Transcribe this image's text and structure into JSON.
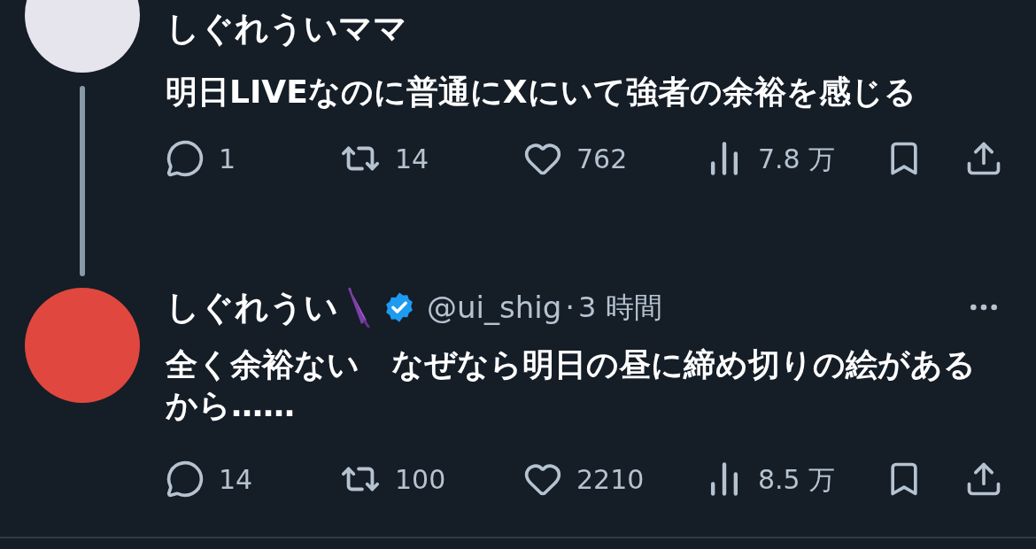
{
  "tweets": [
    {
      "author": {
        "name": "しぐれういママ",
        "color": "#e6e4ec"
      },
      "body": "明日LIVEなのに普通にXにいて強者の余裕を感じる",
      "stats": {
        "replies": "1",
        "reposts": "14",
        "likes": "762",
        "views": "7.8 万"
      },
      "thread_line": true
    },
    {
      "author": {
        "name": "しぐれうい",
        "color": "#e0473e",
        "name_emoji": true,
        "verified": true,
        "handle": "@ui_shig",
        "separator": "·",
        "time": "3 時間"
      },
      "body": "全く余裕ない　なぜなら明日の昼に締め切りの絵があるから……",
      "stats": {
        "replies": "14",
        "reposts": "100",
        "likes": "2210",
        "views": "8.5 万"
      },
      "thread_line": false,
      "more_menu": true
    }
  ]
}
